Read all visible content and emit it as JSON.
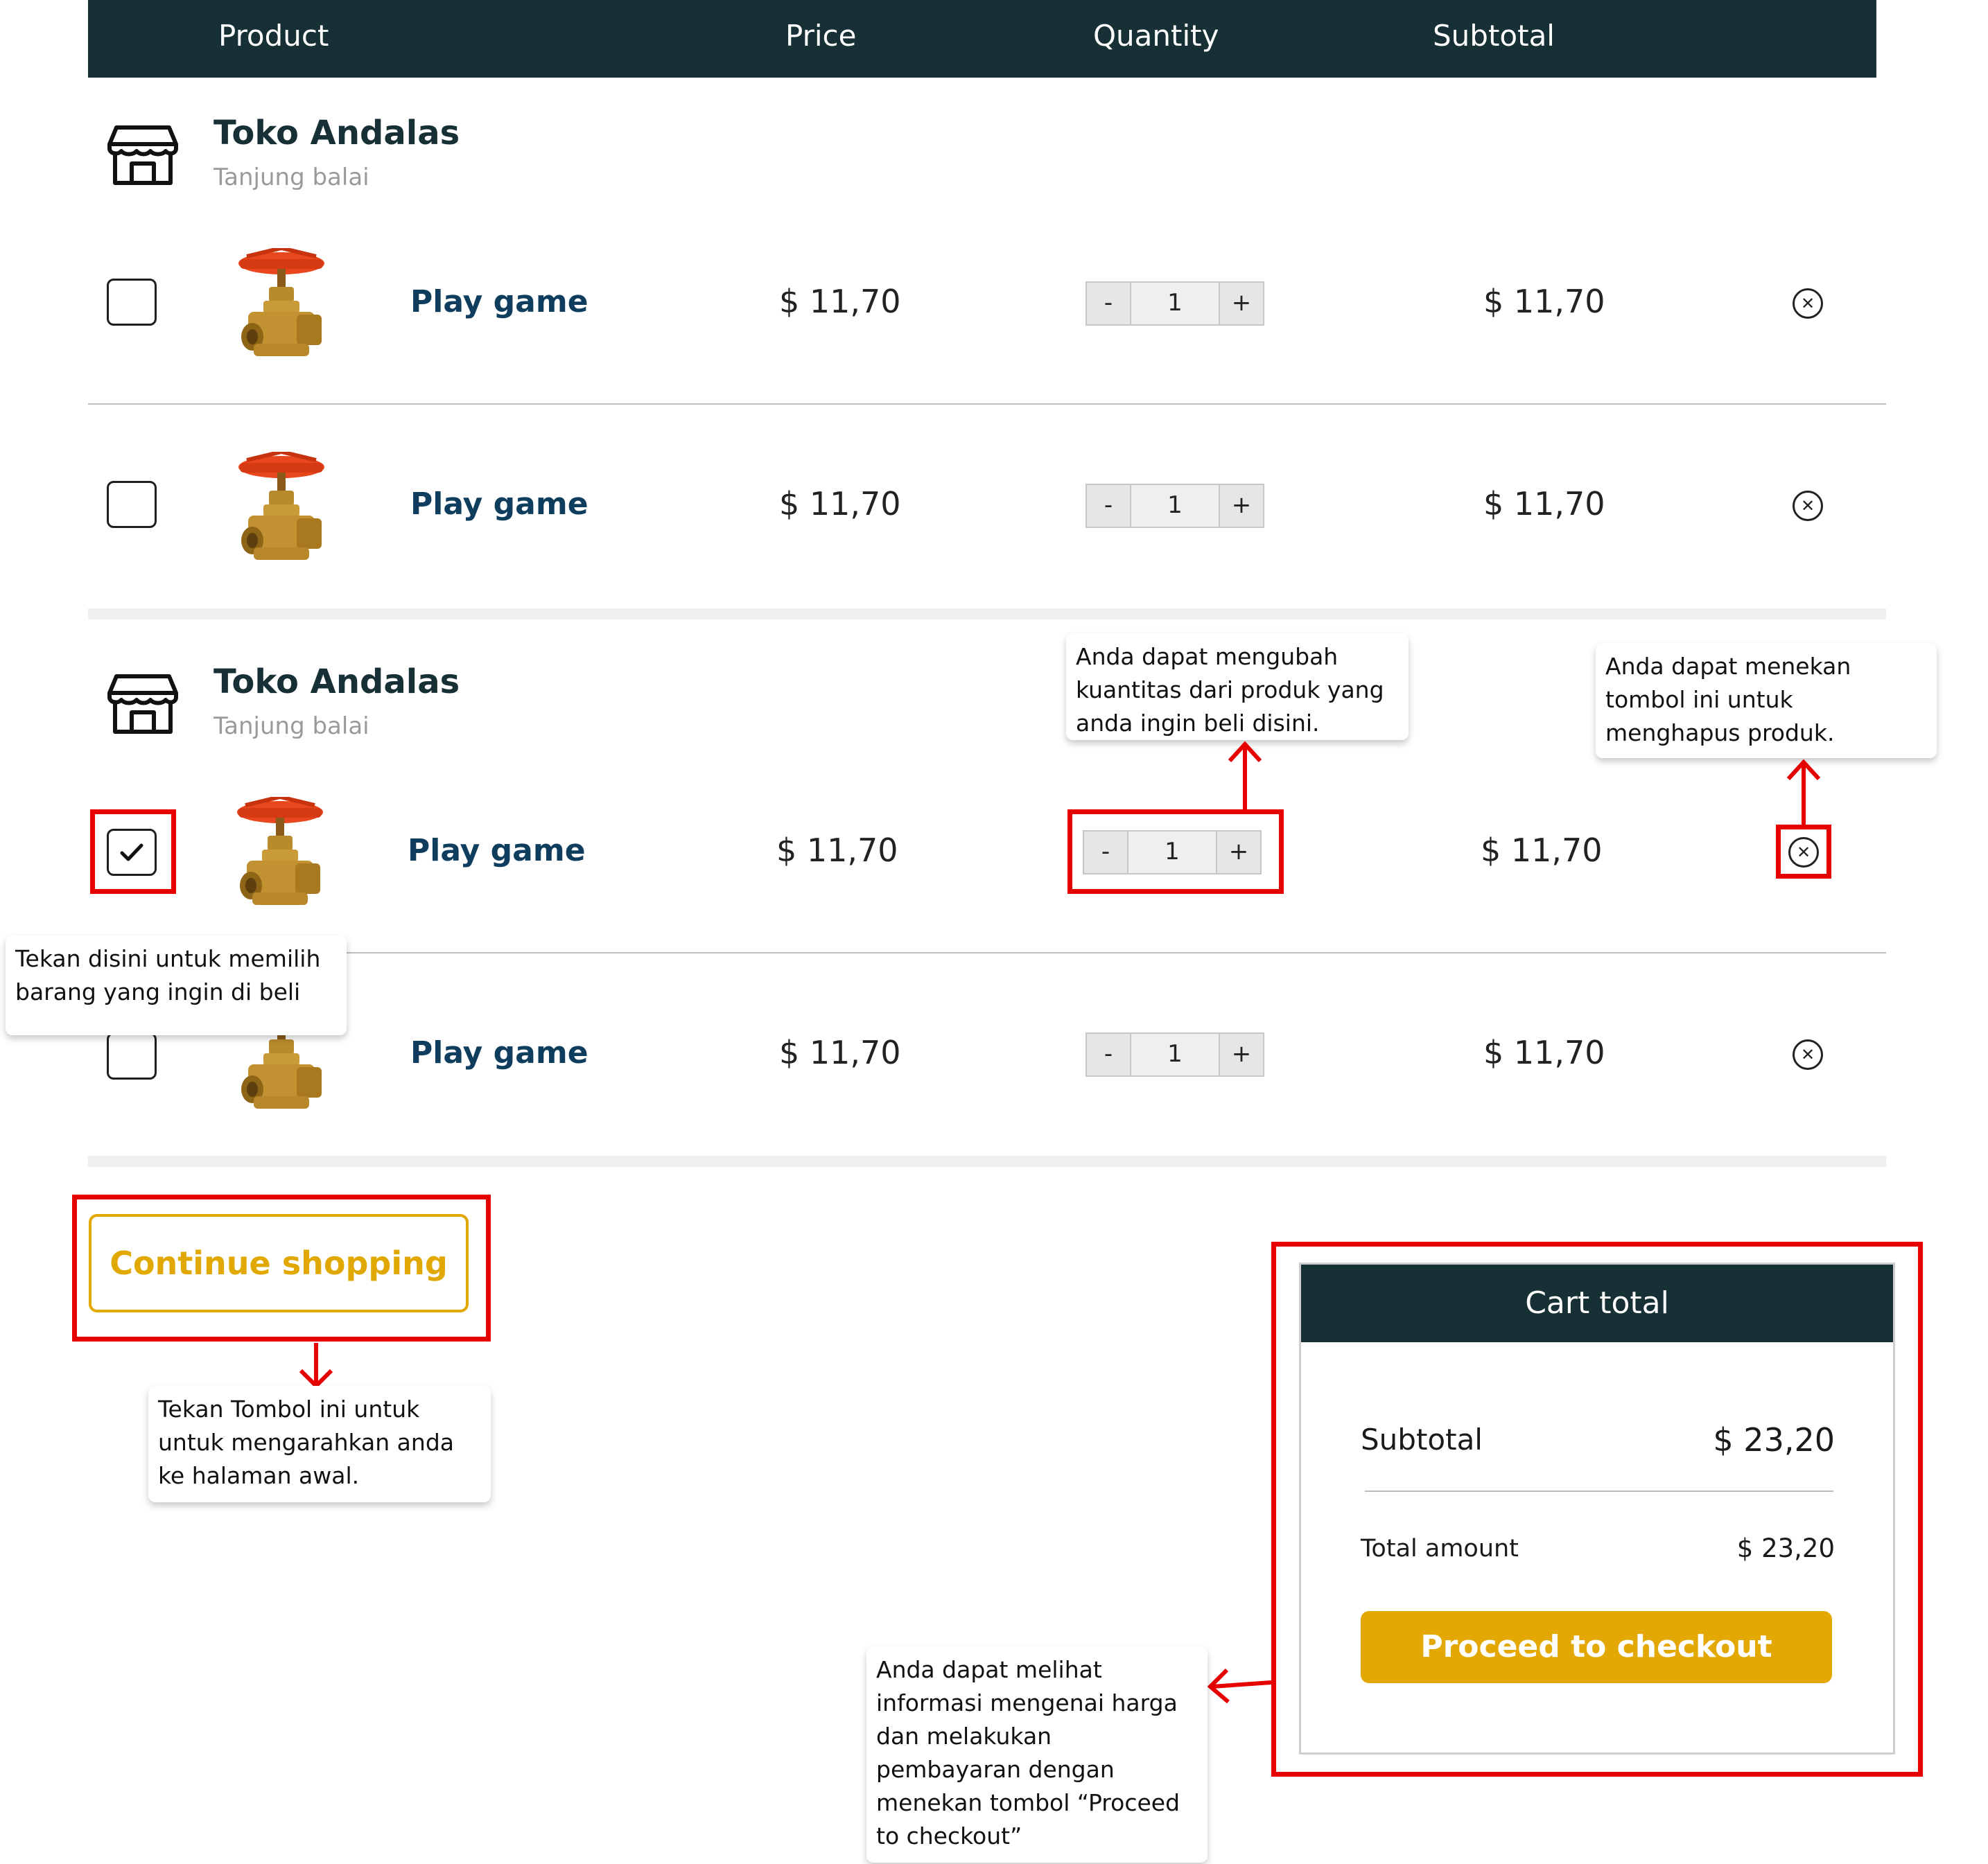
{
  "table_header": {
    "product": "Product",
    "price": "Price",
    "quantity": "Quantity",
    "subtotal": "Subtotal"
  },
  "stores": [
    {
      "name": "Toko Andalas",
      "city": "Tanjung balai",
      "items": [
        {
          "name": "Play game",
          "price": "$ 11,70",
          "qty": "1",
          "subtotal": "$ 11,70",
          "checked": false
        },
        {
          "name": "Play game",
          "price": "$ 11,70",
          "qty": "1",
          "subtotal": "$ 11,70",
          "checked": false
        }
      ]
    },
    {
      "name": "Toko Andalas",
      "city": "Tanjung balai",
      "items": [
        {
          "name": "Play game",
          "price": "$ 11,70",
          "qty": "1",
          "subtotal": "$ 11,70",
          "checked": true
        },
        {
          "name": "Play game",
          "price": "$ 11,70",
          "qty": "1",
          "subtotal": "$ 11,70",
          "checked": false
        }
      ]
    }
  ],
  "qty_controls": {
    "minus": "-",
    "plus": "+"
  },
  "remove_icon": "close-circle-icon",
  "continue_shopping": "Continue shopping",
  "cart_total": {
    "title": "Cart total",
    "subtotal_label": "Subtotal",
    "subtotal_value": "$ 23,20",
    "total_label": "Total amount",
    "total_value": "$ 23,20",
    "checkout_label": "Proceed to checkout"
  },
  "callouts": {
    "quantity": "Anda dapat mengubah kuantitas dari produk yang anda ingin beli disini.",
    "remove": "Anda dapat menekan tombol ini untuk menghapus produk.",
    "select": "Tekan disini untuk memilih barang yang ingin di beli",
    "continue": "Tekan Tombol ini untuk untuk mengarahkan anda ke halaman awal.",
    "checkout": "Anda dapat melihat informasi mengenai harga dan melakukan pembayaran dengan menekan tombol “Proceed to checkout”"
  },
  "colors": {
    "header_bg": "#163035",
    "accent": "#e3a803",
    "highlight": "#e60000",
    "product_name": "#0f3d5e"
  }
}
